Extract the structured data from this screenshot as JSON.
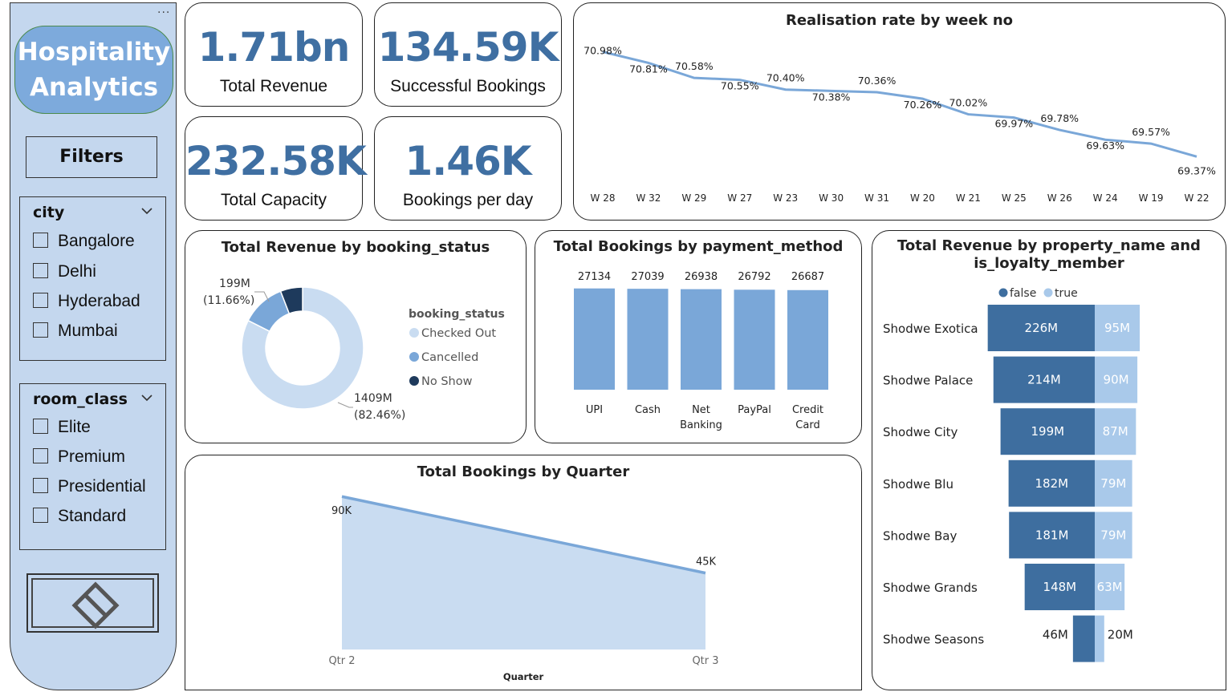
{
  "sidebar": {
    "title_line1": "Hospitality",
    "title_line2": "Analytics",
    "filters_label": "Filters",
    "city_slicer": {
      "title": "city",
      "items": [
        "Bangalore",
        "Delhi",
        "Hyderabad",
        "Mumbai"
      ]
    },
    "room_class_slicer": {
      "title": "room_class",
      "items": [
        "Elite",
        "Premium",
        "Presidential",
        "Standard"
      ]
    },
    "more_label": "..."
  },
  "kpis": {
    "revenue": {
      "value": "1.71bn",
      "label": "Total Revenue"
    },
    "bookings": {
      "value": "134.59K",
      "label": "Successful Bookings"
    },
    "capacity": {
      "value": "232.58K",
      "label": "Total Capacity"
    },
    "per_day": {
      "value": "1.46K",
      "label": "Bookings per day"
    }
  },
  "colors": {
    "accent": "#7aa7d8",
    "dark": "#3e6e9f",
    "light": "#a9c9ea",
    "pale": "#c9dcf1",
    "navy": "#1e3a5c"
  },
  "chart_data": [
    {
      "type": "line",
      "title": "Realisation rate by week no",
      "categories": [
        "W 28",
        "W 32",
        "W 29",
        "W 27",
        "W 23",
        "W 30",
        "W 31",
        "W 20",
        "W 21",
        "W 25",
        "W 26",
        "W 24",
        "W 19",
        "W 22"
      ],
      "values": [
        70.98,
        70.81,
        70.58,
        70.55,
        70.4,
        70.38,
        70.36,
        70.26,
        70.02,
        69.97,
        69.78,
        69.63,
        69.57,
        69.37
      ],
      "labels": [
        "70.98%",
        "70.81%",
        "70.58%",
        "70.55%",
        "70.40%",
        "70.38%",
        "70.36%",
        "70.26%",
        "70.02%",
        "69.97%",
        "69.78%",
        "69.63%",
        "69.57%",
        "69.37%"
      ],
      "ylim": [
        69.3,
        71.05
      ]
    },
    {
      "type": "pie",
      "title": "Total Revenue by booking_status",
      "legend_title": "booking_status",
      "categories": [
        "Checked Out",
        "Cancelled",
        "No Show"
      ],
      "values": [
        82.46,
        11.66,
        5.88
      ],
      "data_labels": [
        {
          "value": "1409M",
          "pct": "(82.46%)"
        },
        {
          "value": "199M",
          "pct": "(11.66%)"
        }
      ]
    },
    {
      "type": "bar",
      "title": "Total Bookings by payment_method",
      "categories": [
        "UPI",
        "Cash",
        "Net Banking",
        "PayPal",
        "Credit Card"
      ],
      "values": [
        27134,
        27039,
        26938,
        26792,
        26687
      ],
      "ylim": [
        0,
        27500
      ]
    },
    {
      "type": "bar",
      "title": "Total Revenue by property_name and is_loyalty_member",
      "legend": [
        "false",
        "true"
      ],
      "categories": [
        "Shodwe Exotica",
        "Shodwe Palace",
        "Shodwe City",
        "Shodwe Blu",
        "Shodwe Bay",
        "Shodwe Grands",
        "Shodwe Seasons"
      ],
      "series": [
        {
          "name": "false",
          "values": [
            226,
            214,
            199,
            182,
            181,
            148,
            46
          ],
          "labels": [
            "226M",
            "214M",
            "199M",
            "182M",
            "181M",
            "148M",
            "46M"
          ]
        },
        {
          "name": "true",
          "values": [
            95,
            90,
            87,
            79,
            79,
            63,
            20
          ],
          "labels": [
            "95M",
            "90M",
            "87M",
            "79M",
            "79M",
            "63M",
            "20M"
          ]
        }
      ]
    },
    {
      "type": "area",
      "title": "Total Bookings by Quarter",
      "xlabel": "Quarter",
      "categories": [
        "Qtr 2",
        "Qtr 3"
      ],
      "values": [
        90,
        45
      ],
      "labels": [
        "90K",
        "45K"
      ],
      "ylim": [
        0,
        92
      ]
    }
  ]
}
